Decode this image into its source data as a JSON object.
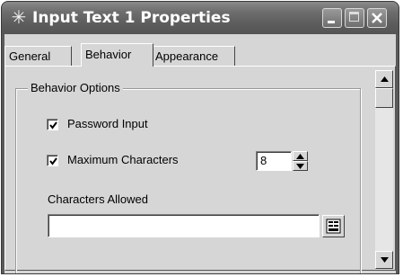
{
  "window": {
    "title": "Input Text 1 Properties",
    "icon": "asterisk-icon"
  },
  "tabs": [
    {
      "label": "General",
      "selected": false
    },
    {
      "label": "Behavior",
      "selected": true
    },
    {
      "label": "Appearance",
      "selected": false
    }
  ],
  "behavior_options": {
    "group_label": "Behavior Options",
    "password_input": {
      "label": "Password Input",
      "checked": true
    },
    "maximum_characters": {
      "label": "Maximum Characters",
      "checked": true,
      "value": "8"
    },
    "characters_allowed": {
      "label": "Characters Allowed",
      "value": ""
    }
  },
  "colors": {
    "titlebar": "#5c5c5c",
    "face": "#d6d6d6"
  }
}
